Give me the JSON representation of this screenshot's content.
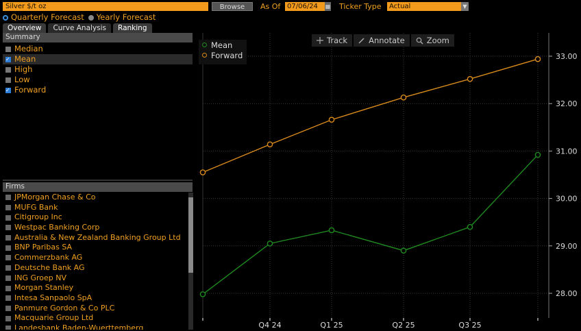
{
  "toolbar": {
    "security": "Silver $/t oz",
    "browse_label": "Browse",
    "as_of_label": "As Of",
    "as_of_value": "07/06/24",
    "ticker_type_label": "Ticker Type",
    "ticker_type_value": "Actual"
  },
  "forecast_mode": {
    "quarterly_label": "Quarterly Forecast",
    "yearly_label": "Yearly Forecast",
    "selected": "Quarterly Forecast"
  },
  "tabs": [
    {
      "label": "Overview",
      "active": false
    },
    {
      "label": "Curve Analysis",
      "active": true
    },
    {
      "label": "Ranking",
      "active": false
    }
  ],
  "summary": {
    "header": "Summary",
    "items": [
      {
        "label": "Median",
        "checked": false
      },
      {
        "label": "Mean",
        "checked": true
      },
      {
        "label": "High",
        "checked": false
      },
      {
        "label": "Low",
        "checked": false
      },
      {
        "label": "Forward",
        "checked": true
      }
    ]
  },
  "firms": {
    "header": "Firms",
    "items": [
      "JPMorgan Chase & Co",
      "MUFG Bank",
      "Citigroup Inc",
      "Westpac Banking Corp",
      "Australia & New Zealand Banking Group Ltd",
      "BNP Paribas SA",
      "Commerzbank AG",
      "Deutsche Bank AG",
      "ING Groep NV",
      "Morgan Stanley",
      "Intesa Sanpaolo SpA",
      "Panmure Gordon & Co PLC",
      "Macquarie Group Ltd",
      "Landesbank Baden-Wuerttemberg"
    ]
  },
  "chart_tools": {
    "track": "Track",
    "annotate": "Annotate",
    "zoom": "Zoom"
  },
  "colors": {
    "mean": "#1f8a1f",
    "forward": "#d98a1c",
    "accent": "#f29a1c"
  },
  "chart_data": {
    "type": "line",
    "categories": [
      "",
      "Q4 24",
      "Q1 25",
      "Q2 25",
      "Q3 25",
      ""
    ],
    "series": [
      {
        "name": "Mean",
        "values": [
          27.98,
          29.05,
          29.33,
          28.9,
          29.4,
          30.92
        ]
      },
      {
        "name": "Forward",
        "values": [
          30.55,
          31.14,
          31.66,
          32.13,
          32.52,
          32.94
        ]
      }
    ],
    "y_ticks": [
      "28.00",
      "29.00",
      "30.00",
      "31.00",
      "32.00",
      "33.00"
    ],
    "ylim": [
      27.5,
      33.3
    ],
    "grid": true,
    "legend": "top-left"
  }
}
